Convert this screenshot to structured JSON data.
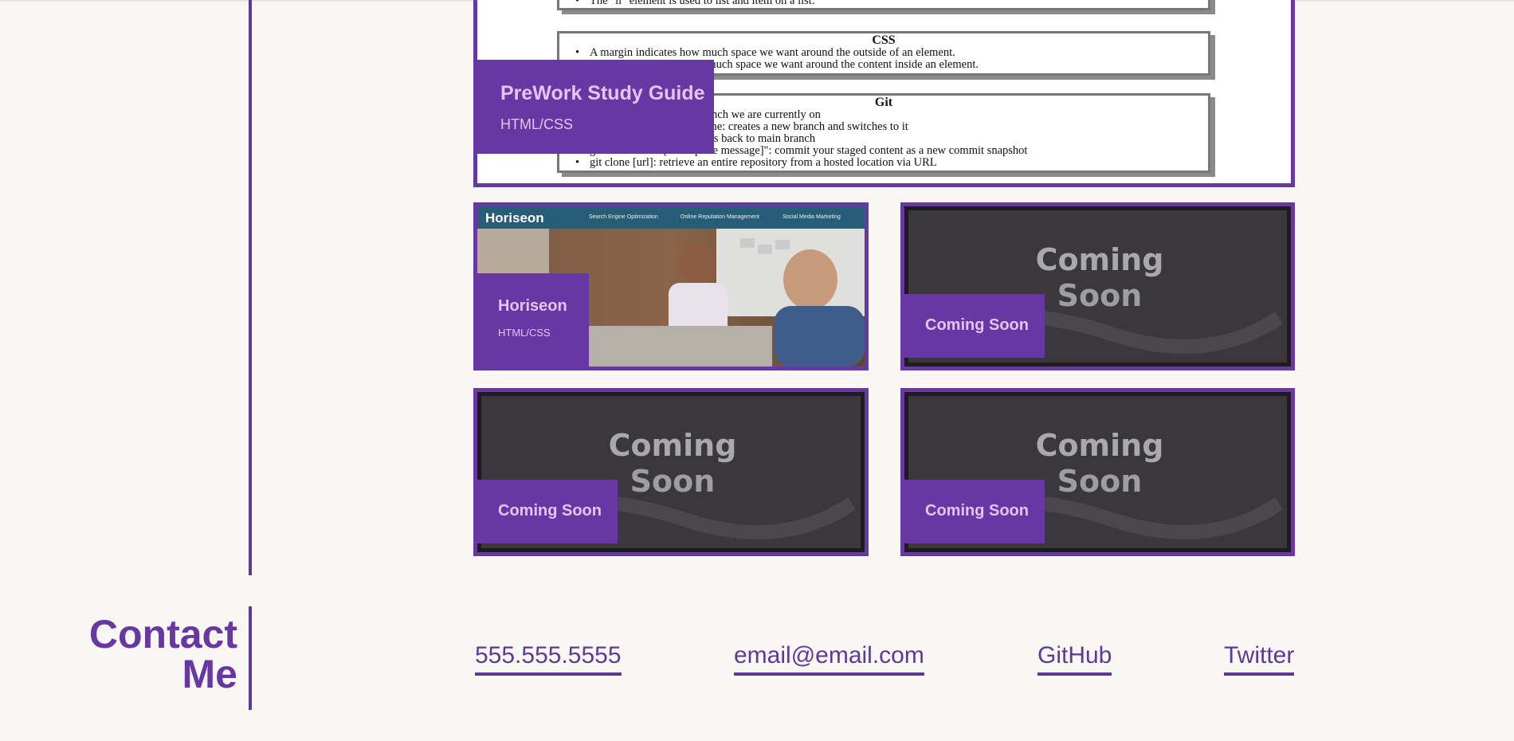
{
  "work": {
    "featured": {
      "title": "PreWork Study Guide",
      "subtitle": "HTML/CSS",
      "doc": {
        "top_bullet": "The \"li\" element is used to list and item on a list.",
        "css_heading": "CSS",
        "css_items": [
          "A margin indicates how much space we want around the outside of an element.",
          "A padding indicates how much space we want around the content inside an element."
        ],
        "git_heading": "Git",
        "git_items": [
          "git status: checks what branch we are currently on",
          "git checkout -b branch-name: creates a new branch and switches to it",
          "git checkout main: switches back to main branch",
          "git commit -m \"[descriptive message]\": commit your staged content as a new commit snapshot",
          "git clone [url]: retrieve an entire repository from a hosted location via URL"
        ]
      }
    },
    "horiseon": {
      "title": "Horiseon",
      "subtitle": "HTML/CSS",
      "screenshot": {
        "logo": "Horiseon",
        "nav": [
          "Search Engine Optimization",
          "Online Reputation Management",
          "Social Media Marketing"
        ]
      }
    },
    "coming_soon": [
      {
        "label": "Coming Soon",
        "image_text": "Coming Soon"
      },
      {
        "label": "Coming Soon",
        "image_text": "Coming Soon"
      },
      {
        "label": "Coming Soon",
        "image_text": "Coming Soon"
      }
    ]
  },
  "contact": {
    "title_line1": "Contact",
    "title_line2": "Me",
    "phone": "555.555.5555",
    "email": "email@email.com",
    "github": "GitHub",
    "twitter": "Twitter"
  },
  "colors": {
    "accent": "#6737a2",
    "caption_text": "#e7c2f2",
    "background": "#f9f7f4"
  }
}
